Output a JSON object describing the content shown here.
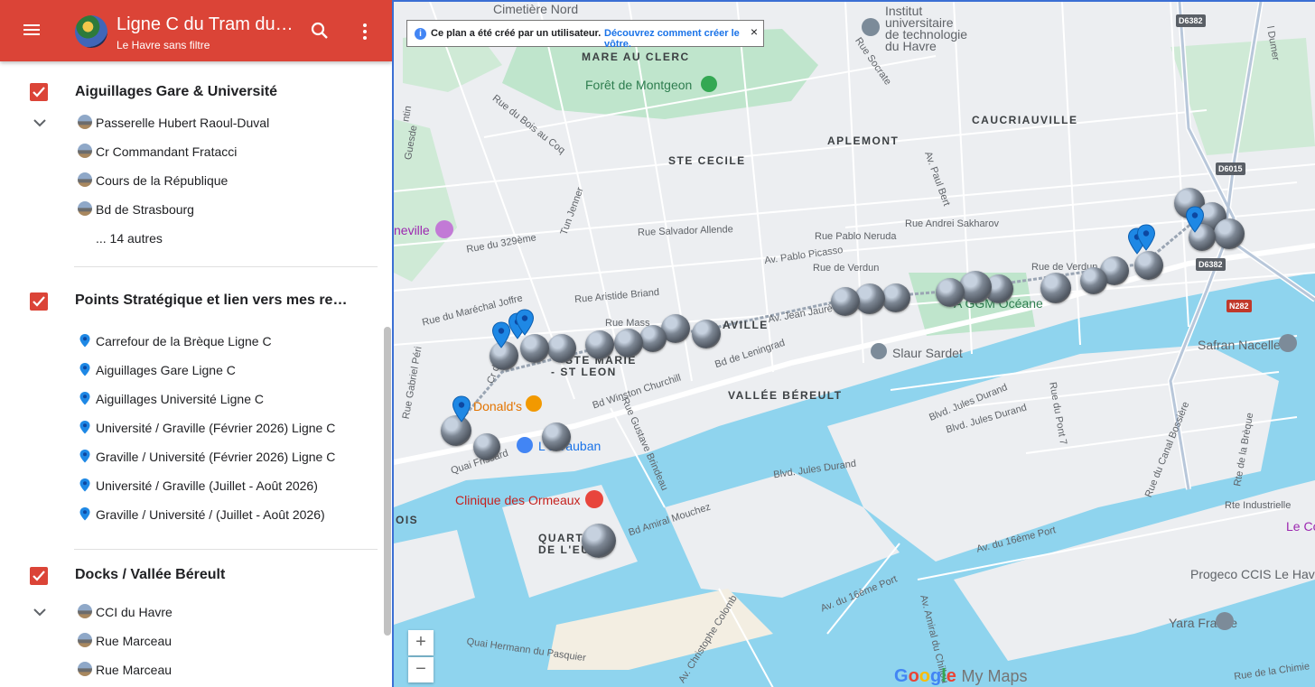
{
  "header": {
    "title": "Ligne C du Tram du H...",
    "subtitle": "Le Havre sans filtre"
  },
  "layers": [
    {
      "title": "Aiguillages Gare & Université",
      "items": [
        {
          "label": "Passerelle Hubert Raoul-Duval",
          "icon": "photo-thumbnail"
        },
        {
          "label": "Cr Commandant Fratacci",
          "icon": "photo-thumbnail"
        },
        {
          "label": "Cours de la République",
          "icon": "photo-thumbnail"
        },
        {
          "label": "Bd de Strasbourg",
          "icon": "photo-thumbnail"
        }
      ],
      "more": "... 14 autres"
    },
    {
      "title": "Points Stratégique et lien vers mes repor...",
      "items": [
        {
          "label": "Carrefour de la Brèque Ligne C",
          "icon": "map-pin"
        },
        {
          "label": "Aiguillages Gare Ligne C",
          "icon": "map-pin"
        },
        {
          "label": "Aiguillages Université Ligne C",
          "icon": "map-pin"
        },
        {
          "label": "Université / Graville (Février 2026) Ligne C",
          "icon": "map-pin"
        },
        {
          "label": "Graville / Université (Février 2026) Ligne C",
          "icon": "map-pin"
        },
        {
          "label": "Université / Graville (Juillet - Août 2026)",
          "icon": "map-pin"
        },
        {
          "label": "Graville / Université / (Juillet - Août 2026)",
          "icon": "map-pin"
        }
      ]
    },
    {
      "title": "Docks / Vallée Béreult",
      "items": [
        {
          "label": "CCI du Havre",
          "icon": "photo-thumbnail"
        },
        {
          "label": "Rue Marceau",
          "icon": "photo-thumbnail"
        },
        {
          "label": "Rue Marceau",
          "icon": "photo-thumbnail"
        }
      ]
    }
  ],
  "map": {
    "banner_text": "Ce plan a été créé par un utilisateur.",
    "banner_link": "Découvrez comment créer le vôtre.",
    "banner_close": "×",
    "zoom_in": "+",
    "zoom_out": "−",
    "logo_letters": [
      "G",
      "o",
      "o",
      "g",
      "l",
      "e"
    ],
    "logo_product": "My Maps",
    "districts": {
      "mare_au_clerc": "MARE AU CLERC",
      "caucriauville": "CAUCRIAUVILLE",
      "aplemont": "APLEMONT",
      "ste_cecile": "STE CECILE",
      "ste_marie": "STE MARIE",
      "st_leon": "- ST LEON",
      "vallee_bereult": "VALLÉE BÉREULT",
      "aville": "AVILLE",
      "quartier": "QUART",
      "de_leu": "DE L'EU",
      "ois": "OIS"
    },
    "pois": {
      "cimetiere": "Cimetière Nord",
      "institut_1": "Institut",
      "institut_2": "universitaire",
      "institut_3": "de technologie",
      "institut_4": "du Havre",
      "foret": "Forêt de Montgeon",
      "neville": "neville",
      "slaur": "Slaur Sardet",
      "safran": "Safran Nacelles",
      "mcdonalds": "Donald's",
      "vauban": "L   s Vauban",
      "clinique": "Clinique des Ormeaux",
      "ggm": "A GGM Océane",
      "proceco": "Progeco CCIS Le Havr",
      "yara": "Yara France",
      "le_co": "Le Co"
    },
    "streets": {
      "rue_socrate": "Rue Socrate",
      "rue_bois_au_coq": "Rue du Bois au Coq",
      "av_paul_bert": "Av. Paul Bert",
      "rue_andrei": "Rue Andrei Sakharov",
      "rue_salvador": "Rue Salvador Allende",
      "rue_pablo_neruda": "Rue Pablo Neruda",
      "av_pablo_picasso": "Av. Pablo Picasso",
      "rue_verdun_1": "Rue de Verdun",
      "rue_verdun_2": "Rue de Verdun",
      "rue_329": "Rue du 329ème",
      "tun_jenner": "Tun Jenner",
      "rue_aristide": "Rue Aristide Briand",
      "rue_marechal": "Rue du Maréchal Joffre",
      "rue_mass": "Rue Mass",
      "av_jean_jaures": "Av. Jean Jaurè",
      "bd_leningrad": "Bd de Leningrad",
      "bd_churchill": "Bd Winston Churchill",
      "rue_gustave": "Rue Gustave Brindeau",
      "blvd_jules_1": "Blvd. Jules Durand",
      "blvd_jules_2": "Blvd. Jules Durand",
      "blvd_jules_3": "Blvd. Jules Durand",
      "rue_pont": "Rue du Pont 7",
      "rue_canal": "Rue du Canal Bossière",
      "rte_breque": "Rte de la Brèque",
      "rte_industrielle": "Rte Industrielle",
      "av_16_1": "Av. du 16ème Port",
      "av_16_2": "Av. du 16ème Port",
      "bd_amiral": "Bd Amiral Mouchez",
      "av_amiral_chillou": "Av. Amiral du Chillou",
      "av_christophe": "Av. Christophe Colomb",
      "quai_hermann": "Quai Hermann du Pasquier",
      "quai_frissard": "Quai Frissard",
      "rue_gabriel": "Rue Gabriel Péri",
      "cr_de": "Cr de",
      "rue_chimie": "Rue de la Chimie",
      "dumer": "l Dumer",
      "gesse": "Guesde",
      "intin": "ntin"
    },
    "road_badges": [
      "D6382",
      "D6015",
      "D6382",
      "N282"
    ]
  },
  "colors": {
    "header": "#db4437",
    "pin": "#1e88e5",
    "water": "#8fd4ee",
    "park": "#bfe5cc",
    "road": "#ffffff",
    "land": "#eceef1",
    "link": "#1a73e8"
  }
}
